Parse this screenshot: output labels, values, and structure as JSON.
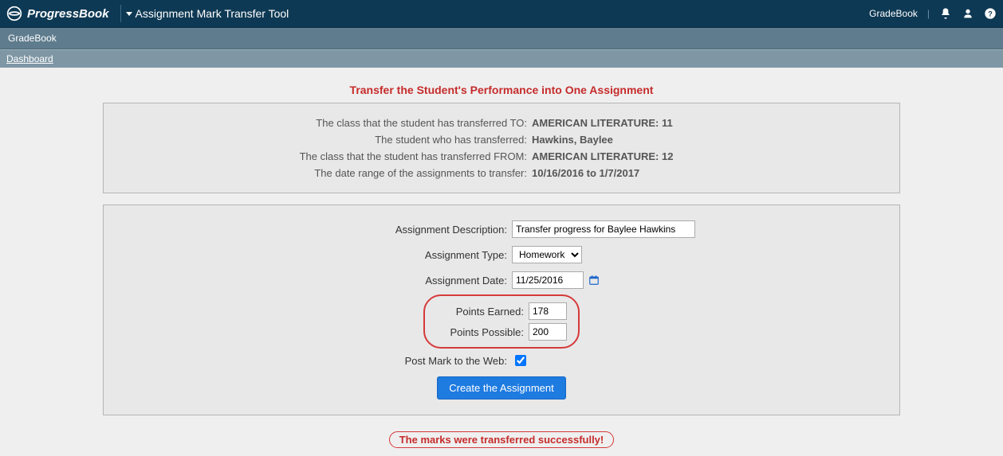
{
  "header": {
    "brand": "ProgressBook",
    "tool_title": "Assignment Mark Transfer Tool",
    "right_label": "GradeBook"
  },
  "subnav": {
    "app": "GradeBook",
    "breadcrumb": "Dashboard"
  },
  "page": {
    "title": "Transfer the Student's Performance into One Assignment",
    "info": {
      "to_label": "The class that the student has transferred TO:",
      "to_value": "AMERICAN LITERATURE: 11",
      "student_label": "The student who has transferred:",
      "student_value": "Hawkins, Baylee",
      "from_label": "The class that the student has transferred FROM:",
      "from_value": "AMERICAN LITERATURE: 12",
      "range_label": "The date range of the assignments to transfer:",
      "range_value": "10/16/2016 to 1/7/2017"
    },
    "form": {
      "desc_label": "Assignment Description:",
      "desc_value": "Transfer progress for Baylee Hawkins",
      "type_label": "Assignment Type:",
      "type_value": "Homework",
      "date_label": "Assignment Date:",
      "date_value": "11/25/2016",
      "earned_label": "Points Earned:",
      "earned_value": "178",
      "possible_label": "Points Possible:",
      "possible_value": "200",
      "post_label": "Post Mark to the Web:",
      "submit_label": "Create the Assignment"
    },
    "success": "The marks were transferred successfully!"
  }
}
